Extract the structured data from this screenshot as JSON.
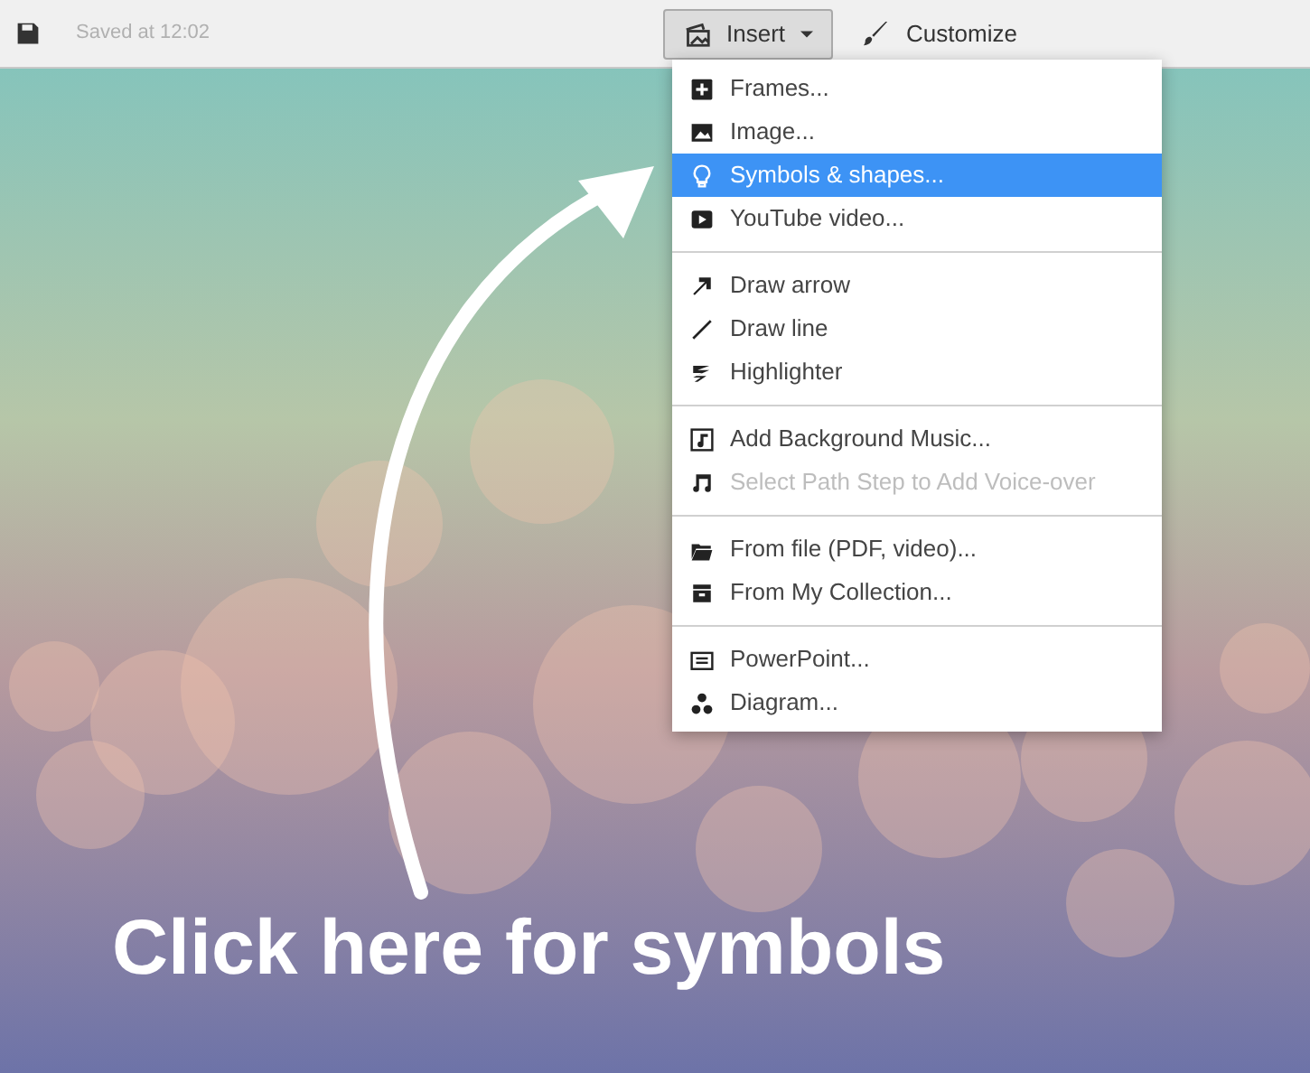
{
  "toolbar": {
    "save_status": "Saved at 12:02",
    "insert_button": {
      "label": "Insert",
      "expanded": true
    },
    "customize_button": {
      "label": "Customize"
    }
  },
  "insert_menu": {
    "groups": [
      [
        {
          "label": "Frames...",
          "selected": false,
          "disabled": false
        },
        {
          "label": "Image...",
          "selected": false,
          "disabled": false
        },
        {
          "label": "Symbols & shapes...",
          "selected": true,
          "disabled": false
        },
        {
          "label": "YouTube video...",
          "selected": false,
          "disabled": false
        }
      ],
      [
        {
          "label": "Draw arrow",
          "selected": false,
          "disabled": false
        },
        {
          "label": "Draw line",
          "selected": false,
          "disabled": false
        },
        {
          "label": "Highlighter",
          "selected": false,
          "disabled": false
        }
      ],
      [
        {
          "label": "Add Background Music...",
          "selected": false,
          "disabled": false
        },
        {
          "label": "Select Path Step to Add Voice-over",
          "selected": false,
          "disabled": true
        }
      ],
      [
        {
          "label": "From file (PDF, video)...",
          "selected": false,
          "disabled": false
        },
        {
          "label": "From My Collection...",
          "selected": false,
          "disabled": false
        }
      ],
      [
        {
          "label": "PowerPoint...",
          "selected": false,
          "disabled": false
        },
        {
          "label": "Diagram...",
          "selected": false,
          "disabled": false
        }
      ]
    ]
  },
  "annotation": {
    "caption": "Click here for symbols"
  }
}
